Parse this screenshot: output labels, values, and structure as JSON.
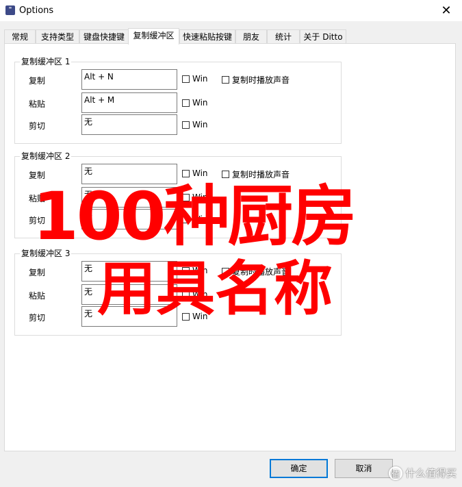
{
  "window": {
    "title": "Options",
    "close_glyph": "✕",
    "icon_glyph": "\""
  },
  "tabs": [
    {
      "label": "常规"
    },
    {
      "label": "支持类型"
    },
    {
      "label": "键盘快捷键"
    },
    {
      "label": "复制缓冲区"
    },
    {
      "label": "快速粘贴按键"
    },
    {
      "label": "朋友"
    },
    {
      "label": "统计"
    },
    {
      "label": "关于 Ditto"
    }
  ],
  "active_tab": "复制缓冲区",
  "groups": [
    {
      "title": "复制缓冲区 1",
      "rows": [
        {
          "label": "复制",
          "value": "Alt + N",
          "win": "Win",
          "sound": "复制时播放声音"
        },
        {
          "label": "粘贴",
          "value": "Alt + M",
          "win": "Win"
        },
        {
          "label": "剪切",
          "value": "无",
          "win": "Win"
        }
      ]
    },
    {
      "title": "复制缓冲区 2",
      "rows": [
        {
          "label": "复制",
          "value": "无",
          "win": "Win",
          "sound": "复制时播放声音"
        },
        {
          "label": "粘贴",
          "value": "无",
          "win": "Win"
        },
        {
          "label": "剪切",
          "value": "无",
          "win": "Win"
        }
      ]
    },
    {
      "title": "复制缓冲区 3",
      "rows": [
        {
          "label": "复制",
          "value": "无",
          "win": "Win",
          "sound": "复制时播放声音"
        },
        {
          "label": "粘贴",
          "value": "无",
          "win": "Win"
        },
        {
          "label": "剪切",
          "value": "无",
          "win": "Win"
        }
      ]
    }
  ],
  "buttons": {
    "ok": "确定",
    "cancel": "取消"
  },
  "overlay": {
    "line1": "100种厨房",
    "line2": "用具名称",
    "color": "#ff0000"
  },
  "watermark": {
    "icon_glyph": "值",
    "text": "什么值得买"
  }
}
